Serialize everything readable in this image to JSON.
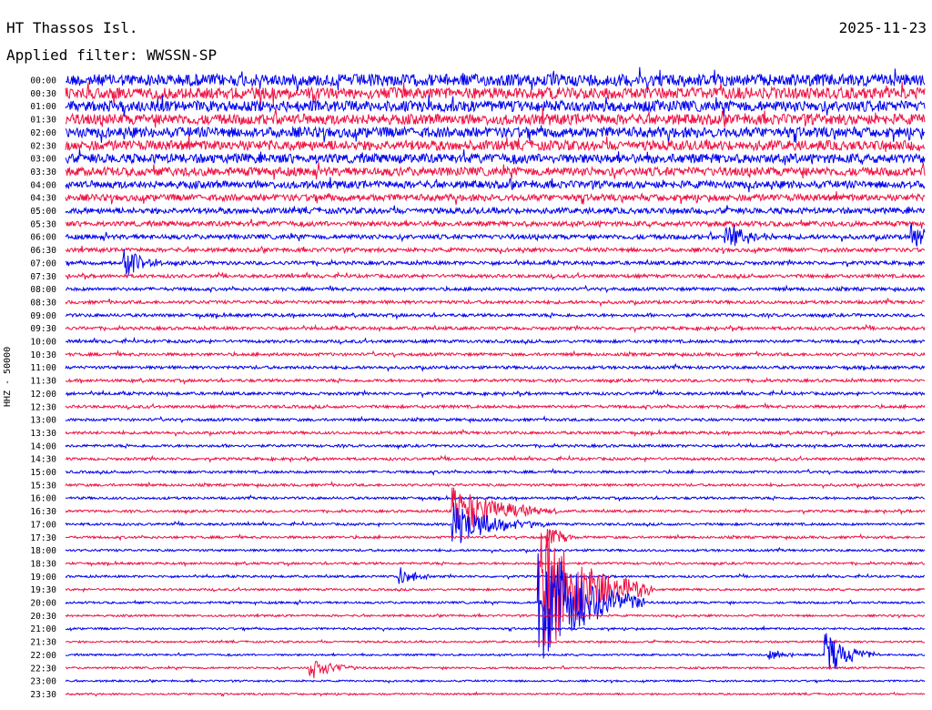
{
  "header": {
    "station": "HT Thassos Isl.",
    "date": "2025-11-23",
    "filter": "Applied filter: WWSSN-SP"
  },
  "chart_data": {
    "type": "helicorder",
    "title": "HT Thassos Isl.",
    "date": "2025-11-23",
    "filter": "WWSSN-SP",
    "ylabel": "HHZ - 50000",
    "row_minutes": 30,
    "row_labels": [
      "00:00",
      "00:30",
      "01:00",
      "01:30",
      "02:00",
      "02:30",
      "03:00",
      "03:30",
      "04:00",
      "04:30",
      "05:00",
      "05:30",
      "06:00",
      "06:30",
      "07:00",
      "07:30",
      "08:00",
      "08:30",
      "09:00",
      "09:30",
      "10:00",
      "10:30",
      "11:00",
      "11:30",
      "12:00",
      "12:30",
      "13:00",
      "13:30",
      "14:00",
      "14:30",
      "15:00",
      "15:30",
      "16:00",
      "16:30",
      "17:00",
      "17:30",
      "18:00",
      "18:30",
      "19:00",
      "19:30",
      "20:00",
      "20:30",
      "21:00",
      "21:30",
      "22:00",
      "22:30",
      "23:00",
      "23:30"
    ],
    "trace_colors": [
      "#0000ee",
      "#ee1144"
    ],
    "noise_amplitude_by_row": [
      1.0,
      0.95,
      0.9,
      0.88,
      0.85,
      0.82,
      0.78,
      0.72,
      0.62,
      0.55,
      0.48,
      0.42,
      0.38,
      0.33,
      0.3,
      0.28,
      0.27,
      0.27,
      0.26,
      0.26,
      0.25,
      0.25,
      0.25,
      0.24,
      0.24,
      0.24,
      0.23,
      0.23,
      0.22,
      0.22,
      0.21,
      0.21,
      0.2,
      0.2,
      0.2,
      0.2,
      0.19,
      0.19,
      0.18,
      0.18,
      0.18,
      0.17,
      0.17,
      0.16,
      0.16,
      0.16,
      0.15,
      0.15
    ],
    "events": [
      {
        "row_time": "06:00",
        "minute": 23.0,
        "amplitude": 1.2,
        "duration_min": 0.8
      },
      {
        "row_time": "06:00",
        "minute": 29.5,
        "amplitude": 1.2,
        "duration_min": 0.7
      },
      {
        "row_time": "07:00",
        "minute": 2.0,
        "amplitude": 1.3,
        "duration_min": 0.6
      },
      {
        "row_time": "16:30",
        "minute": 13.5,
        "amplitude": 2.2,
        "duration_min": 1.5
      },
      {
        "row_time": "17:00",
        "minute": 13.5,
        "amplitude": 1.8,
        "duration_min": 1.3
      },
      {
        "row_time": "17:30",
        "minute": 16.8,
        "amplitude": 1.0,
        "duration_min": 0.5
      },
      {
        "row_time": "19:00",
        "minute": 11.6,
        "amplitude": 1.0,
        "duration_min": 0.5
      },
      {
        "row_time": "19:30",
        "minute": 16.5,
        "amplitude": 6.0,
        "duration_min": 1.6
      },
      {
        "row_time": "20:00",
        "minute": 16.5,
        "amplitude": 5.5,
        "duration_min": 1.5
      },
      {
        "row_time": "22:00",
        "minute": 26.5,
        "amplitude": 1.8,
        "duration_min": 0.8
      },
      {
        "row_time": "22:00",
        "minute": 24.5,
        "amplitude": 0.4,
        "duration_min": 0.6
      },
      {
        "row_time": "22:30",
        "minute": 8.5,
        "amplitude": 1.0,
        "duration_min": 0.7
      }
    ]
  }
}
